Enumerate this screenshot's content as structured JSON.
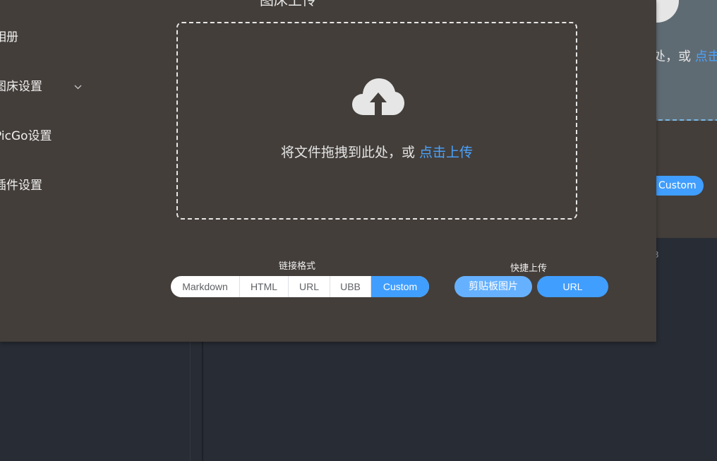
{
  "background": {
    "upload_text_fragment": "处，或 ",
    "upload_link_fragment": "点击",
    "custom_button": "Custom",
    "mark": "3"
  },
  "page_title": "图床上传",
  "sidebar": {
    "items": [
      {
        "label": "相册"
      },
      {
        "label": "图床设置",
        "icon": "chevron-down-icon"
      },
      {
        "label": "PicGo设置"
      },
      {
        "label": "插件设置"
      }
    ]
  },
  "upload": {
    "icon": "cloud-upload-icon",
    "text": "将文件拖拽到此处，或 ",
    "link": "点击上传"
  },
  "link_format": {
    "label": "链接格式",
    "options": [
      "Markdown",
      "HTML",
      "URL",
      "UBB",
      "Custom"
    ],
    "selected": "Custom"
  },
  "quick_upload": {
    "label": "快捷上传",
    "clipboard_button": "剪贴板图片",
    "url_button": "URL"
  },
  "colors": {
    "accent": "#409eff",
    "accent_light": "#66b1ff",
    "window_bg": "#433e3a",
    "app_bg": "#282c34"
  }
}
